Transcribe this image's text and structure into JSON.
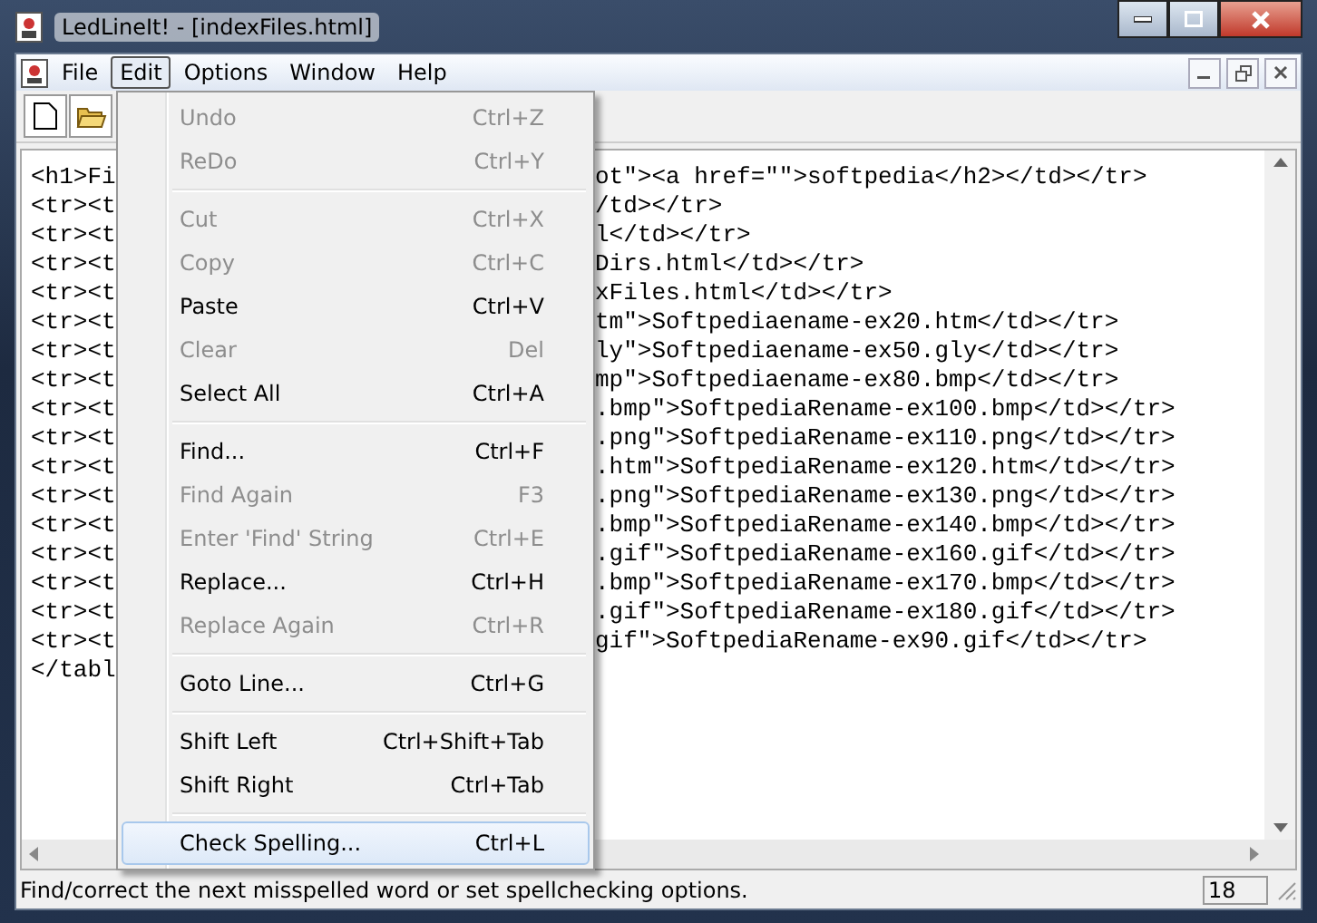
{
  "window": {
    "title": "LedLineIt! - [indexFiles.html]"
  },
  "menubar": [
    {
      "label": "File",
      "selected": false
    },
    {
      "label": "Edit",
      "selected": true
    },
    {
      "label": "Options",
      "selected": false
    },
    {
      "label": "Window",
      "selected": false
    },
    {
      "label": "Help",
      "selected": false
    }
  ],
  "editor_lines": [
    {
      "left": "<h1>Fi",
      "right": "ot\"><a href=\"\">softpedia</h2></td></tr>"
    },
    {
      "left": "<tr><t",
      "right": "/td></tr>"
    },
    {
      "left": "<tr><t",
      "right": "l</td></tr>"
    },
    {
      "left": "<tr><t",
      "right": "Dirs.html</td></tr>"
    },
    {
      "left": "<tr><t",
      "right": "xFiles.html</td></tr>"
    },
    {
      "left": "<tr><t",
      "right": "tm\">Softpediaename-ex20.htm</td></tr>"
    },
    {
      "left": "<tr><t",
      "right": "ly\">Softpediaename-ex50.gly</td></tr>"
    },
    {
      "left": "<tr><t",
      "right": "mp\">Softpediaename-ex80.bmp</td></tr>"
    },
    {
      "left": "<tr><t",
      "right": ".bmp\">SoftpediaRename-ex100.bmp</td></tr>"
    },
    {
      "left": "<tr><t",
      "right": ".png\">SoftpediaRename-ex110.png</td></tr>"
    },
    {
      "left": "<tr><t",
      "right": ".htm\">SoftpediaRename-ex120.htm</td></tr>"
    },
    {
      "left": "<tr><t",
      "right": ".png\">SoftpediaRename-ex130.png</td></tr>"
    },
    {
      "left": "<tr><t",
      "right": ".bmp\">SoftpediaRename-ex140.bmp</td></tr>"
    },
    {
      "left": "<tr><t",
      "right": ".gif\">SoftpediaRename-ex160.gif</td></tr>"
    },
    {
      "left": "<tr><t",
      "right": ".bmp\">SoftpediaRename-ex170.bmp</td></tr>"
    },
    {
      "left": "<tr><t",
      "right": ".gif\">SoftpediaRename-ex180.gif</td></tr>"
    },
    {
      "left": "<tr><t",
      "right": "gif\">SoftpediaRename-ex90.gif</td></tr>"
    },
    {
      "left": "</tabl"
    }
  ],
  "edit_menu": [
    {
      "kind": "item",
      "label": "Undo",
      "shortcut": "Ctrl+Z",
      "disabled": true,
      "selected": false
    },
    {
      "kind": "item",
      "label": "ReDo",
      "shortcut": "Ctrl+Y",
      "disabled": true,
      "selected": false
    },
    {
      "kind": "separator"
    },
    {
      "kind": "item",
      "label": "Cut",
      "shortcut": "Ctrl+X",
      "disabled": true,
      "selected": false
    },
    {
      "kind": "item",
      "label": "Copy",
      "shortcut": "Ctrl+C",
      "disabled": true,
      "selected": false
    },
    {
      "kind": "item",
      "label": "Paste",
      "shortcut": "Ctrl+V",
      "disabled": false,
      "selected": false
    },
    {
      "kind": "item",
      "label": "Clear",
      "shortcut": "Del",
      "disabled": true,
      "selected": false
    },
    {
      "kind": "item",
      "label": "Select All",
      "shortcut": "Ctrl+A",
      "disabled": false,
      "selected": false
    },
    {
      "kind": "separator"
    },
    {
      "kind": "item",
      "label": "Find...",
      "shortcut": "Ctrl+F",
      "disabled": false,
      "selected": false
    },
    {
      "kind": "item",
      "label": "Find Again",
      "shortcut": "F3",
      "disabled": true,
      "selected": false
    },
    {
      "kind": "item",
      "label": "Enter 'Find' String",
      "shortcut": "Ctrl+E",
      "disabled": true,
      "selected": false
    },
    {
      "kind": "item",
      "label": "Replace...",
      "shortcut": "Ctrl+H",
      "disabled": false,
      "selected": false
    },
    {
      "kind": "item",
      "label": "Replace Again",
      "shortcut": "Ctrl+R",
      "disabled": true,
      "selected": false
    },
    {
      "kind": "separator"
    },
    {
      "kind": "item",
      "label": "Goto Line...",
      "shortcut": "Ctrl+G",
      "disabled": false,
      "selected": false
    },
    {
      "kind": "separator"
    },
    {
      "kind": "item",
      "label": "Shift Left",
      "shortcut": "Ctrl+Shift+Tab",
      "disabled": false,
      "selected": false
    },
    {
      "kind": "item",
      "label": "Shift Right",
      "shortcut": "Ctrl+Tab",
      "disabled": false,
      "selected": false
    },
    {
      "kind": "separator"
    },
    {
      "kind": "item",
      "label": "Check Spelling...",
      "shortcut": "Ctrl+L",
      "disabled": false,
      "selected": true
    }
  ],
  "status_bar": {
    "message": "Find/correct the next misspelled word or set spellchecking options.",
    "line": "18"
  }
}
